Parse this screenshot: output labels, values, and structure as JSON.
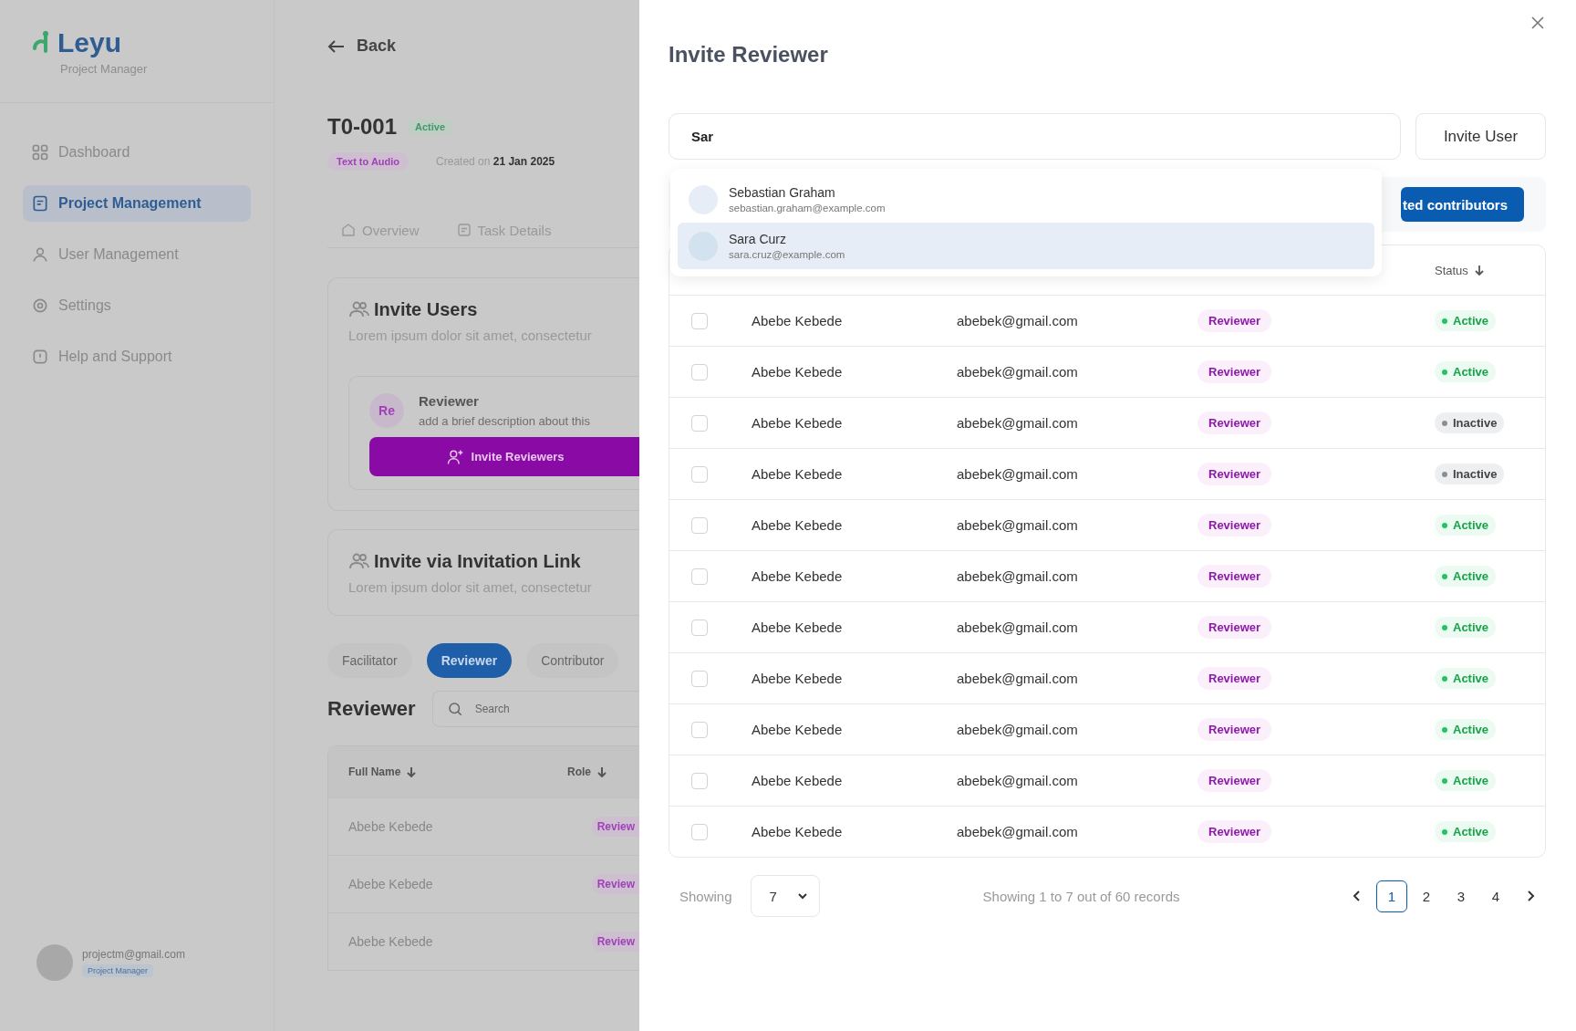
{
  "background": {
    "sidebar": {
      "logo": "Leyu",
      "subtitle": "Project Manager",
      "items": [
        {
          "label": "Dashboard",
          "selected": false
        },
        {
          "label": "Project Management",
          "selected": true
        },
        {
          "label": "User Management",
          "selected": false
        },
        {
          "label": "Settings",
          "selected": false
        },
        {
          "label": "Help and Support",
          "selected": false
        }
      ],
      "user": {
        "email": "projectm@gmail.com",
        "role": "Project Manager"
      }
    },
    "page": {
      "back": "Back",
      "title": "T0-001",
      "status": "Active",
      "type_tag": "Text to Audio",
      "created_label": "Created on",
      "created_date": "21 Jan 2025",
      "tabs": [
        {
          "label": "Overview",
          "selected": false
        },
        {
          "label": "Task Details",
          "selected": false
        }
      ],
      "invite_users": {
        "title": "Invite Users",
        "description": "Lorem ipsum dolor sit amet, consectetur",
        "role_card": {
          "initials": "Re",
          "title": "Reviewer",
          "description": "add a brief description about this",
          "button": "Invite Reviewers"
        }
      },
      "invite_link": {
        "title": "Invite via Invitation Link",
        "description": "Lorem ipsum dolor sit amet, consectetur"
      },
      "role_tabs": [
        {
          "label": "Facilitator",
          "selected": false
        },
        {
          "label": "Reviewer",
          "selected": true
        },
        {
          "label": "Contributor",
          "selected": false
        }
      ],
      "list_title": "Reviewer",
      "search": {
        "placeholder": "Search"
      },
      "table": {
        "columns": [
          "Full Name",
          "Role"
        ],
        "rows": [
          {
            "name": "Abebe Kebede",
            "role": "Review"
          },
          {
            "name": "Abebe Kebede",
            "role": "Review"
          },
          {
            "name": "Abebe Kebede",
            "role": "Review"
          }
        ]
      }
    }
  },
  "drawer": {
    "title": "Invite Reviewer",
    "search": {
      "value": "Sar"
    },
    "invite_button": "Invite User",
    "contributors_button": "ted contributors",
    "suggestions": [
      {
        "name": "Sebastian Graham",
        "email": "sebastian.graham@example.com",
        "selected": false
      },
      {
        "name": "Sara Curz",
        "email": "sara.cruz@example.com",
        "selected": true
      }
    ],
    "table": {
      "columns": [
        "Status"
      ],
      "rows": [
        {
          "checked": false,
          "name": "Abebe Kebede",
          "email": "abebek@gmail.com",
          "role": "Reviewer",
          "status": "Active",
          "active": true
        },
        {
          "checked": false,
          "name": "Abebe Kebede",
          "email": "abebek@gmail.com",
          "role": "Reviewer",
          "status": "Active",
          "active": true
        },
        {
          "checked": false,
          "name": "Abebe Kebede",
          "email": "abebek@gmail.com",
          "role": "Reviewer",
          "status": "Inactive",
          "active": false
        },
        {
          "checked": false,
          "name": "Abebe Kebede",
          "email": "abebek@gmail.com",
          "role": "Reviewer",
          "status": "Inactive",
          "active": false
        },
        {
          "checked": false,
          "name": "Abebe Kebede",
          "email": "abebek@gmail.com",
          "role": "Reviewer",
          "status": "Active",
          "active": true
        },
        {
          "checked": false,
          "name": "Abebe Kebede",
          "email": "abebek@gmail.com",
          "role": "Reviewer",
          "status": "Active",
          "active": true
        },
        {
          "checked": false,
          "name": "Abebe Kebede",
          "email": "abebek@gmail.com",
          "role": "Reviewer",
          "status": "Active",
          "active": true
        },
        {
          "checked": false,
          "name": "Abebe Kebede",
          "email": "abebek@gmail.com",
          "role": "Reviewer",
          "status": "Active",
          "active": true
        },
        {
          "checked": false,
          "name": "Abebe Kebede",
          "email": "abebek@gmail.com",
          "role": "Reviewer",
          "status": "Active",
          "active": true
        },
        {
          "checked": false,
          "name": "Abebe Kebede",
          "email": "abebek@gmail.com",
          "role": "Reviewer",
          "status": "Active",
          "active": true
        },
        {
          "checked": false,
          "name": "Abebe Kebede",
          "email": "abebek@gmail.com",
          "role": "Reviewer",
          "status": "Active",
          "active": true
        }
      ]
    },
    "footer": {
      "showing_label": "Showing",
      "page_size": "7",
      "summary": "Showing 1 to 7 out of 60 records",
      "pages": [
        {
          "label": "1",
          "selected": true
        },
        {
          "label": "2",
          "selected": false
        },
        {
          "label": "3",
          "selected": false
        },
        {
          "label": "4",
          "selected": false
        }
      ]
    }
  }
}
